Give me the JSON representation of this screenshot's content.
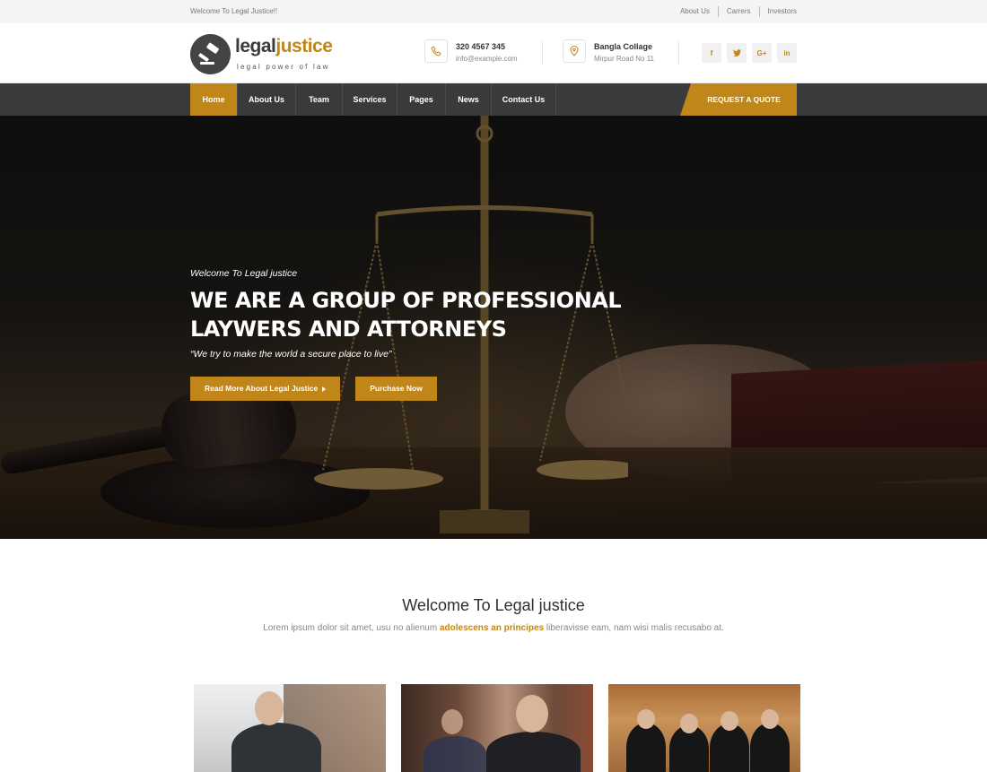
{
  "topbar": {
    "welcome": "Welcome To Legal Justice!!",
    "links": [
      "About Us",
      "Carrers",
      "Investors"
    ]
  },
  "header": {
    "logo_word1": "legal",
    "logo_word2": "justice",
    "tagline": "legal power of law",
    "phone_title": "320 4567 345",
    "phone_sub": "info@example.com",
    "address_title": "Bangla Collage",
    "address_sub": "Mirpur Road No 11",
    "social": [
      "f",
      "t",
      "G+",
      "in"
    ]
  },
  "nav": {
    "items": [
      "Home",
      "About Us",
      "Team",
      "Services",
      "Pages",
      "News",
      "Contact Us"
    ],
    "active": "Home",
    "quote_button": "REQUEST A QUOTE"
  },
  "hero": {
    "welcome": "Welcome To Legal justice",
    "title_line1": "WE ARE A GROUP OF PROFESSIONAL",
    "title_line2": "LAYWERS AND ATTORNEYS",
    "quote": "“We try to make the world a secure place to live”",
    "btn_read_more": "Read More About Legal Justice",
    "btn_purchase": "Purchase Now"
  },
  "welcome_section": {
    "title": "Welcome To Legal justice",
    "sub_before": "Lorem ipsum dolor sit amet, usu no alienum",
    "sub_highlight": "adolescens an principes",
    "sub_after": "liberavisse eam, nam wisi malis recusabo at."
  },
  "colors": {
    "accent": "#c1861a",
    "nav_bg": "#3a3a3a",
    "topbar_bg": "#f4f4f4"
  }
}
